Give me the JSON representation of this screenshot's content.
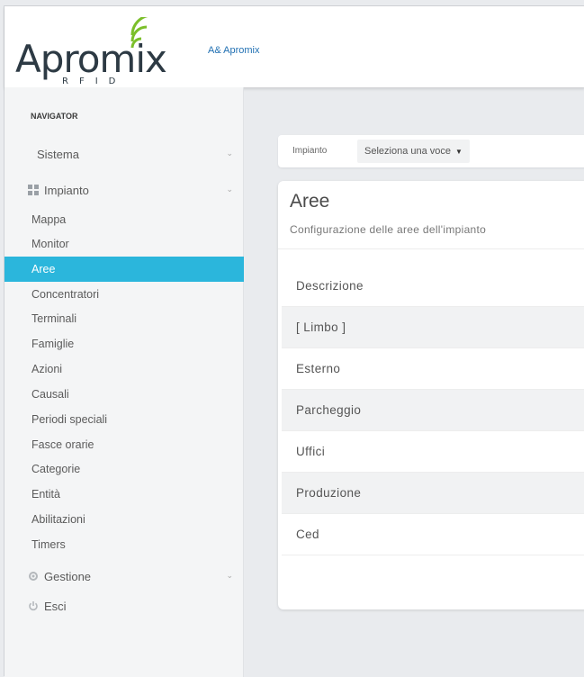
{
  "header": {
    "logo_word": "Apromix",
    "logo_sub": "RFID",
    "company": "A& Apromix"
  },
  "colors": {
    "accent": "#2bb6dc",
    "link": "#1f6fb2",
    "logo_green": "#7bbf2a"
  },
  "sidebar": {
    "title": "NAVIGATOR",
    "sections": [
      {
        "label": "Sistema",
        "icon": "none"
      },
      {
        "label": "Impianto",
        "icon": "grid-icon"
      },
      {
        "label": "Gestione",
        "icon": "gear-icon"
      },
      {
        "label": "Esci",
        "icon": "power-icon"
      }
    ],
    "items": [
      "Mappa",
      "Monitor",
      "Aree",
      "Concentratori",
      "Terminali",
      "Famiglie",
      "Azioni",
      "Causali",
      "Periodi speciali",
      "Fasce orarie",
      "Categorie",
      "Entità",
      "Abilitazioni",
      "Timers"
    ],
    "active_item": "Aree"
  },
  "filter": {
    "label": "Impianto",
    "select_value": "Seleziona una voce"
  },
  "card": {
    "title": "Aree",
    "subtitle": "Configurazione delle aree dell'impianto",
    "table": {
      "header": "Descrizione",
      "rows": [
        "[ Limbo ]",
        "Esterno",
        "Parcheggio",
        "Uffici",
        "Produzione",
        "Ced"
      ]
    }
  }
}
